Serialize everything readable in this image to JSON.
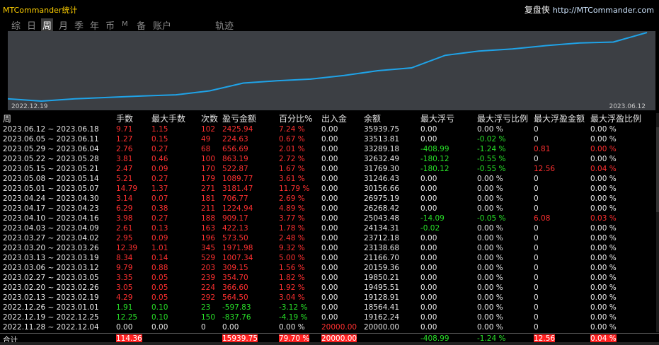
{
  "window": {
    "title": "MTCommander统计",
    "brand_cn": "复盘侠",
    "brand_url": "http://MTCommander.com"
  },
  "tabs": [
    {
      "label": "综",
      "active": false
    },
    {
      "label": "日",
      "active": false
    },
    {
      "label": "周",
      "active": true
    },
    {
      "label": "月",
      "active": false
    },
    {
      "label": "季",
      "active": false
    },
    {
      "label": "年",
      "active": false
    },
    {
      "label": "币",
      "active": false
    },
    {
      "label": "M",
      "active": false
    },
    {
      "label": "备",
      "active": false
    },
    {
      "label": "账户",
      "active": false
    },
    {
      "label": "轨迹",
      "active": false
    }
  ],
  "chart": {
    "start_label": "2022.12.19",
    "end_label": "2023.06.12",
    "line_color": "#1fa3e8",
    "bg_color": "#3c3f44",
    "values": [
      19162.24,
      18564.41,
      19128.91,
      19495.51,
      19850.21,
      20159.36,
      21166.7,
      23138.68,
      23712.18,
      24134.31,
      25043.48,
      26268.42,
      26975.19,
      30156.66,
      31246.43,
      31769.3,
      32632.49,
      33289.18,
      33513.81,
      35939.75
    ]
  },
  "table": {
    "headers": [
      "周",
      "手数",
      "最大手数",
      "次数",
      "盈亏金额",
      "百分比%",
      "出入金",
      "余额",
      "最大浮亏",
      "最大浮亏比例",
      "最大浮盈金额",
      "最大浮盈比例"
    ],
    "rows": [
      [
        "2023.06.12 ~ 2023.06.18",
        "9.71",
        "1.15",
        "102",
        "2425.94",
        "7.24 %",
        "0.00",
        "35939.75",
        "0.00",
        "0.00 %",
        "0",
        "0.00 %"
      ],
      [
        "2023.06.05 ~ 2023.06.11",
        "1.27",
        "0.15",
        "49",
        "224.63",
        "0.67 %",
        "0.00",
        "33513.81",
        "0.00",
        "-0.02 %",
        "0",
        "0.00 %"
      ],
      [
        "2023.05.29 ~ 2023.06.04",
        "2.76",
        "0.27",
        "68",
        "656.69",
        "2.01 %",
        "0.00",
        "33289.18",
        "-408.99",
        "-1.24 %",
        "0.81",
        "0.00 %"
      ],
      [
        "2023.05.22 ~ 2023.05.28",
        "3.81",
        "0.46",
        "100",
        "863.19",
        "2.72 %",
        "0.00",
        "32632.49",
        "-180.12",
        "-0.55 %",
        "0",
        "0.00 %"
      ],
      [
        "2023.05.15 ~ 2023.05.21",
        "2.47",
        "0.09",
        "170",
        "522.87",
        "1.67 %",
        "0.00",
        "31769.30",
        "-180.12",
        "-0.55 %",
        "12.56",
        "0.04 %"
      ],
      [
        "2023.05.08 ~ 2023.05.14",
        "5.21",
        "0.27",
        "179",
        "1089.77",
        "3.61 %",
        "0.00",
        "31246.43",
        "0.00",
        "0.00 %",
        "0",
        "0.00 %"
      ],
      [
        "2023.05.01 ~ 2023.05.07",
        "14.79",
        "1.37",
        "271",
        "3181.47",
        "11.79 %",
        "0.00",
        "30156.66",
        "0.00",
        "0.00 %",
        "0",
        "0.00 %"
      ],
      [
        "2023.04.24 ~ 2023.04.30",
        "3.14",
        "0.07",
        "181",
        "706.77",
        "2.69 %",
        "0.00",
        "26975.19",
        "0.00",
        "0.00 %",
        "0",
        "0.00 %"
      ],
      [
        "2023.04.17 ~ 2023.04.23",
        "6.29",
        "0.38",
        "211",
        "1224.94",
        "4.89 %",
        "0.00",
        "26268.42",
        "0.00",
        "0.00 %",
        "0",
        "0.00 %"
      ],
      [
        "2023.04.10 ~ 2023.04.16",
        "3.98",
        "0.27",
        "188",
        "909.17",
        "3.77 %",
        "0.00",
        "25043.48",
        "-14.09",
        "-0.05 %",
        "6.08",
        "0.03 %"
      ],
      [
        "2023.04.03 ~ 2023.04.09",
        "2.61",
        "0.13",
        "163",
        "422.13",
        "1.78 %",
        "0.00",
        "24134.31",
        "-0.02",
        "0.00 %",
        "0",
        "0.00 %"
      ],
      [
        "2023.03.27 ~ 2023.04.02",
        "2.95",
        "0.09",
        "196",
        "573.50",
        "2.48 %",
        "0.00",
        "23712.18",
        "0.00",
        "0.00 %",
        "0",
        "0.00 %"
      ],
      [
        "2023.03.20 ~ 2023.03.26",
        "12.39",
        "1.01",
        "345",
        "1971.98",
        "9.32 %",
        "0.00",
        "23138.68",
        "0.00",
        "0.00 %",
        "0",
        "0.00 %"
      ],
      [
        "2023.03.13 ~ 2023.03.19",
        "8.34",
        "0.14",
        "529",
        "1007.34",
        "5.00 %",
        "0.00",
        "21166.70",
        "0.00",
        "0.00 %",
        "0",
        "0.00 %"
      ],
      [
        "2023.03.06 ~ 2023.03.12",
        "9.79",
        "0.88",
        "203",
        "309.15",
        "1.56 %",
        "0.00",
        "20159.36",
        "0.00",
        "0.00 %",
        "0",
        "0.00 %"
      ],
      [
        "2023.02.27 ~ 2023.03.05",
        "3.35",
        "0.05",
        "239",
        "354.70",
        "1.82 %",
        "0.00",
        "19850.21",
        "0.00",
        "0.00 %",
        "0",
        "0.00 %"
      ],
      [
        "2023.02.20 ~ 2023.02.26",
        "3.05",
        "0.05",
        "224",
        "366.60",
        "1.92 %",
        "0.00",
        "19495.51",
        "0.00",
        "0.00 %",
        "0",
        "0.00 %"
      ],
      [
        "2023.02.13 ~ 2023.02.19",
        "4.29",
        "0.05",
        "292",
        "564.50",
        "3.04 %",
        "0.00",
        "19128.91",
        "0.00",
        "0.00 %",
        "0",
        "0.00 %"
      ],
      [
        "2022.12.26 ~ 2023.01.01",
        "1.91",
        "0.10",
        "23",
        "-597.83",
        "-3.12 %",
        "0.00",
        "18564.41",
        "0.00",
        "0.00 %",
        "0",
        "0.00 %"
      ],
      [
        "2022.12.19 ~ 2022.12.25",
        "12.25",
        "0.10",
        "150",
        "-837.76",
        "-4.19 %",
        "0.00",
        "19162.24",
        "0.00",
        "0.00 %",
        "0",
        "0.00 %"
      ],
      [
        "2022.11.28 ~ 2022.12.04",
        "0.00",
        "0.00",
        "0",
        "0.00",
        "0.00 %",
        "20000.00",
        "20000.00",
        "0.00",
        "0.00 %",
        "0",
        "0.00 %"
      ]
    ],
    "total": {
      "label": "合计",
      "lots": "114.36",
      "profit": "15939.75",
      "percent": "79.70 %",
      "deposit": "20000.00",
      "max_float_loss": "-408.99",
      "max_float_loss_pct": "-1.24 %",
      "max_float_profit": "12.56",
      "max_float_profit_pct": "0.04 %"
    }
  }
}
